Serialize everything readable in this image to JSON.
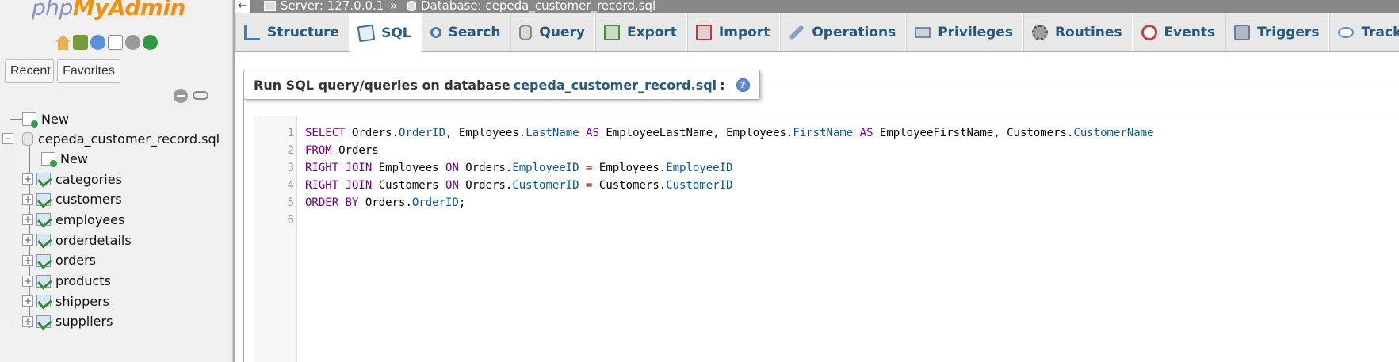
{
  "sidebar": {
    "logo_php": "php",
    "logo_myadmin": "MyAdmin",
    "quick_icons": [
      "home-icon",
      "exit-icon",
      "help-icon",
      "docs-icon",
      "settings-gear-icon",
      "reload-icon"
    ],
    "recent_label": "Recent",
    "favorites_label": "Favorites",
    "new_label": "New",
    "database_name": "cepeda_customer_record.sql",
    "db_new_label": "New",
    "tables": [
      "categories",
      "customers",
      "employees",
      "orderdetails",
      "orders",
      "products",
      "shippers",
      "suppliers"
    ]
  },
  "topbar": {
    "back_symbol": "←",
    "server_label": "Server: 127.0.0.1",
    "separator": "»",
    "database_label": "Database: cepeda_customer_record.sql"
  },
  "tabs": [
    {
      "label": "Structure",
      "icon": "structure-icon"
    },
    {
      "label": "SQL",
      "icon": "sql-icon",
      "active": true
    },
    {
      "label": "Search",
      "icon": "search-icon"
    },
    {
      "label": "Query",
      "icon": "query-icon"
    },
    {
      "label": "Export",
      "icon": "export-icon"
    },
    {
      "label": "Import",
      "icon": "import-icon"
    },
    {
      "label": "Operations",
      "icon": "wrench-icon"
    },
    {
      "label": "Privileges",
      "icon": "privileges-icon"
    },
    {
      "label": "Routines",
      "icon": "routines-icon"
    },
    {
      "label": "Events",
      "icon": "clock-icon"
    },
    {
      "label": "Triggers",
      "icon": "triggers-icon"
    },
    {
      "label": "Tracking",
      "icon": "eye-icon"
    }
  ],
  "main": {
    "legend_prefix": "Run SQL query/queries on database",
    "legend_db": "cepeda_customer_record.sql",
    "legend_suffix": ":",
    "help_symbol": "?"
  },
  "editor": {
    "line_numbers": [
      "1",
      "2",
      "3",
      "4",
      "5",
      "6"
    ],
    "lines": [
      [
        {
          "t": "SELECT",
          "c": "kw"
        },
        {
          "t": " Orders.",
          "c": ""
        },
        {
          "t": "OrderID",
          "c": "fld"
        },
        {
          "t": ", Employees.",
          "c": ""
        },
        {
          "t": "LastName",
          "c": "fld"
        },
        {
          "t": " ",
          "c": ""
        },
        {
          "t": "AS",
          "c": "kw"
        },
        {
          "t": " EmployeeLastName, Employees.",
          "c": ""
        },
        {
          "t": "FirstName",
          "c": "fld"
        },
        {
          "t": " ",
          "c": ""
        },
        {
          "t": "AS",
          "c": "kw"
        },
        {
          "t": " EmployeeFirstName, Customers.",
          "c": ""
        },
        {
          "t": "CustomerName",
          "c": "fld"
        }
      ],
      [
        {
          "t": "FROM",
          "c": "kw"
        },
        {
          "t": " Orders",
          "c": ""
        }
      ],
      [
        {
          "t": "RIGHT JOIN",
          "c": "kw"
        },
        {
          "t": " Employees ",
          "c": ""
        },
        {
          "t": "ON",
          "c": "kw"
        },
        {
          "t": " Orders.",
          "c": ""
        },
        {
          "t": "EmployeeID",
          "c": "fld"
        },
        {
          "t": " ",
          "c": ""
        },
        {
          "t": "=",
          "c": "op"
        },
        {
          "t": " Employees.",
          "c": ""
        },
        {
          "t": "EmployeeID",
          "c": "fld"
        }
      ],
      [
        {
          "t": "RIGHT JOIN",
          "c": "kw"
        },
        {
          "t": " Customers ",
          "c": ""
        },
        {
          "t": "ON",
          "c": "kw"
        },
        {
          "t": " Orders.",
          "c": ""
        },
        {
          "t": "CustomerID",
          "c": "fld"
        },
        {
          "t": " ",
          "c": ""
        },
        {
          "t": "=",
          "c": "op"
        },
        {
          "t": " Customers.",
          "c": ""
        },
        {
          "t": "CustomerID",
          "c": "fld"
        }
      ],
      [
        {
          "t": "ORDER BY",
          "c": "kw"
        },
        {
          "t": " Orders.",
          "c": ""
        },
        {
          "t": "OrderID",
          "c": "fld"
        },
        {
          "t": ";",
          "c": ""
        }
      ],
      []
    ]
  }
}
